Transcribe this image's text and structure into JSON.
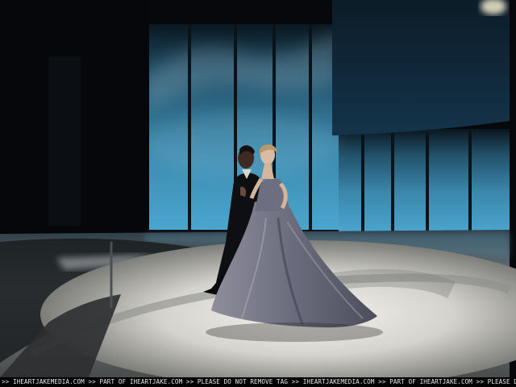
{
  "watermark": {
    "text": ">> IHEARTJAKEMEDIA.COM >> PART OF IHEARTJAKE.COM >> PLEASE DO NOT REMOVE TAG >> IHEARTJAKEMEDIA.COM >> PART OF IHEARTJAKE.COM >> PLEASE DO NOT R"
  },
  "colors": {
    "stage_blue": "#3f8fb4",
    "backdrop_dark": "#06080c",
    "floor_light": "#d9d8d2",
    "gown": "#7d7f8e",
    "bar": "#000000"
  }
}
